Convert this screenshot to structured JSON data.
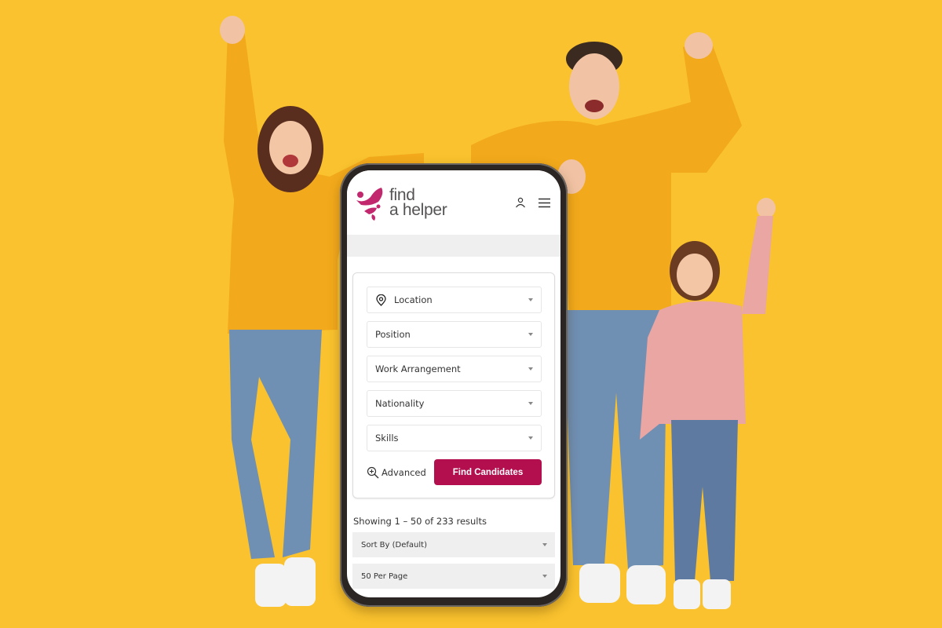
{
  "colors": {
    "background": "#F9C22E",
    "brand": "#B30F4F",
    "logo_pink": "#C2286E",
    "sweater_yellow": "#F2A91B",
    "jeans_blue": "#6F8FB3",
    "kid_sweater_pink": "#E9A6A3"
  },
  "app": {
    "brand_line1": "find",
    "brand_line2": "a helper",
    "header_icons": [
      "user-icon",
      "menu-icon"
    ]
  },
  "search": {
    "fields": [
      {
        "label": "Location",
        "icon": "location-pin-icon"
      },
      {
        "label": "Position"
      },
      {
        "label": "Work Arrangement"
      },
      {
        "label": "Nationality"
      },
      {
        "label": "Skills"
      }
    ],
    "advanced_label": "Advanced",
    "advanced_icon": "zoom-in-icon",
    "submit_label": "Find Candidates"
  },
  "results": {
    "summary": "Showing 1 – 50 of 233 results",
    "sort_by": "Sort By (Default)",
    "per_page": "50 Per Page"
  }
}
